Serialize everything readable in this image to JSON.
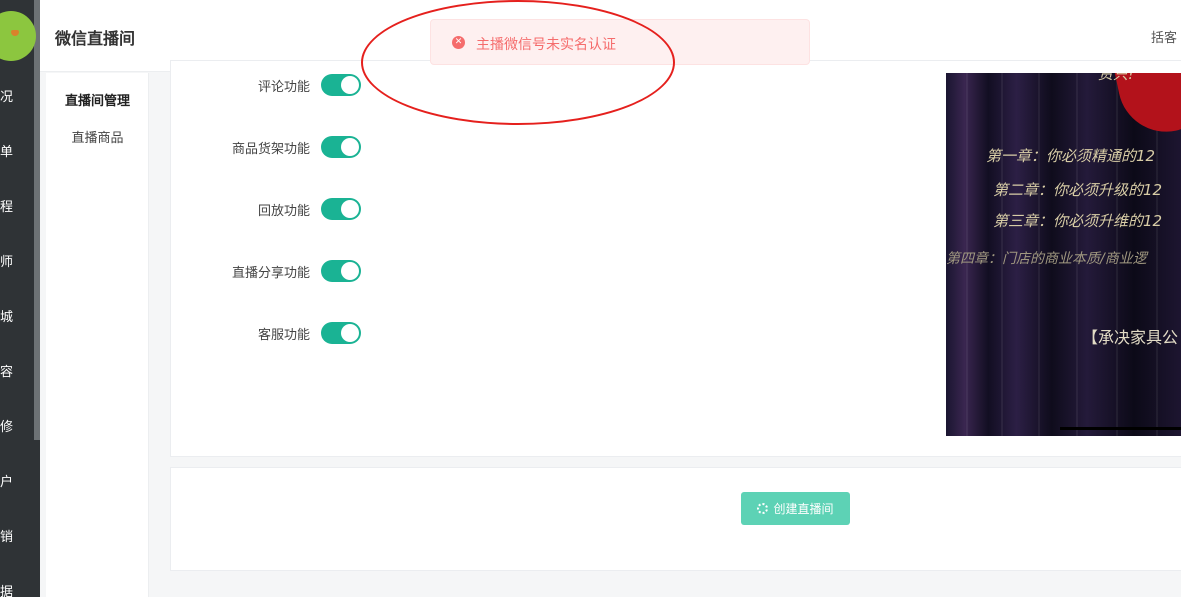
{
  "sidebar": {
    "items": [
      "况",
      "单",
      "程",
      "师",
      "城",
      "容",
      "修",
      "户",
      "销",
      "据"
    ]
  },
  "header": {
    "title": "微信直播间",
    "user": "括客"
  },
  "subnav": {
    "items": [
      "直播间管理",
      "直播商品"
    ]
  },
  "settings": {
    "rows": [
      {
        "label": "评论功能",
        "enabled": true
      },
      {
        "label": "商品货架功能",
        "enabled": true
      },
      {
        "label": "回放功能",
        "enabled": true
      },
      {
        "label": "直播分享功能",
        "enabled": true
      },
      {
        "label": "客服功能",
        "enabled": true
      }
    ]
  },
  "poster": {
    "top_text": "资只!",
    "lines": [
      "第一章：你必须精通的12",
      "第二章：你必须升级的12",
      "第三章：你必须升维的12",
      "第四章：门店的商业本质/商业逻",
      "【承决家具公"
    ]
  },
  "actions": {
    "create_label": "创建直播间"
  },
  "toast": {
    "message": "主播微信号未实名认证",
    "type": "error",
    "icon": "close-circle-icon"
  },
  "colors": {
    "accent": "#1ab394",
    "button": "#5dd2b5",
    "error": "#f56c6c",
    "annotation": "#e5201d"
  }
}
